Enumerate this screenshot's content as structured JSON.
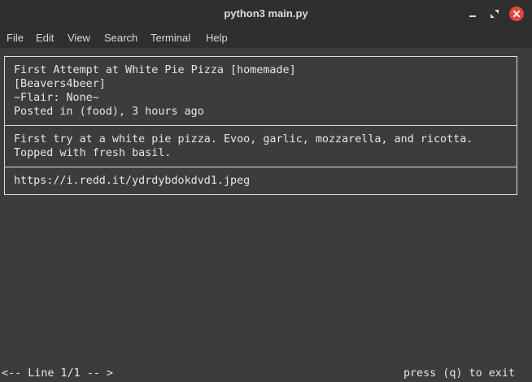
{
  "window": {
    "title": "python3 main.py"
  },
  "menubar": {
    "items": [
      "File",
      "Edit",
      "View",
      "Search",
      "Terminal",
      "Help"
    ]
  },
  "post": {
    "header": {
      "title": "First Attempt at White Pie Pizza [homemade]",
      "author": "[Beavers4beer]",
      "flair": "~Flair: None~",
      "posted": "Posted in (food), 3 hours ago"
    },
    "body": {
      "line1": "First try at a white pie pizza. Evoo, garlic, mozzarella, and ricotta.",
      "line2": "Topped with fresh basil."
    },
    "link": "https://i.redd.it/ydrdybdokdvd1.jpeg"
  },
  "status": {
    "position": "<-- Line 1/1 -- >",
    "hint": "press (q) to exit"
  },
  "colors": {
    "close_button": "#e2463f",
    "background": "#3c3c3c",
    "text": "#e6e6e6"
  },
  "icons": {
    "minimize": "minimize-icon",
    "maximize": "maximize-icon",
    "close": "close-icon"
  }
}
